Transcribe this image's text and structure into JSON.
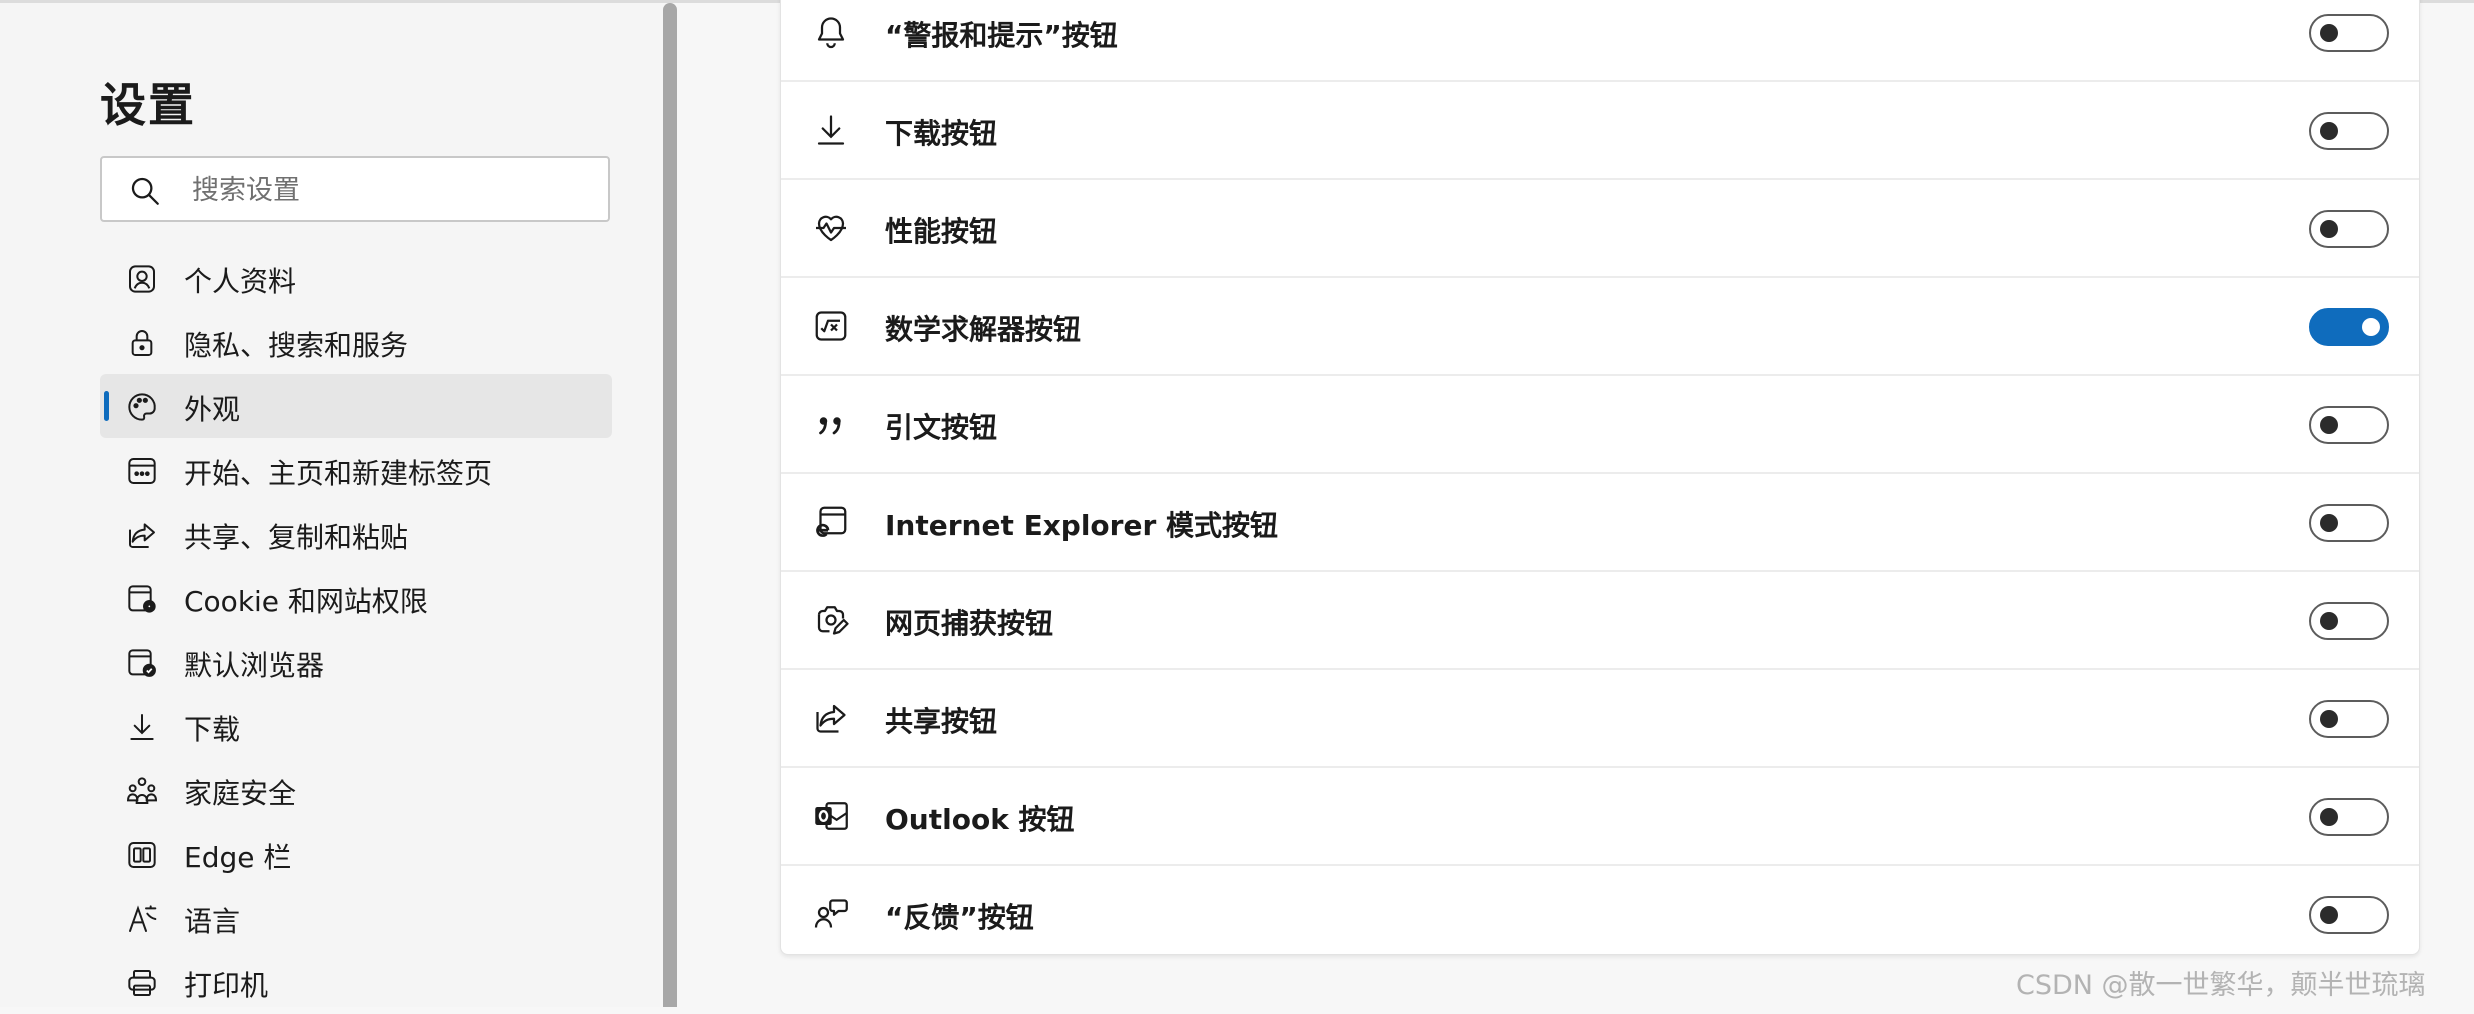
{
  "sidebar": {
    "title": "设置",
    "search": {
      "placeholder": "搜索设置",
      "value": ""
    },
    "items": [
      {
        "label": "个人资料",
        "icon": "profile-icon",
        "active": false
      },
      {
        "label": "隐私、搜索和服务",
        "icon": "lock-icon",
        "active": false
      },
      {
        "label": "外观",
        "icon": "palette-icon",
        "active": true
      },
      {
        "label": "开始、主页和新建标签页",
        "icon": "new-tab-icon",
        "active": false
      },
      {
        "label": "共享、复制和粘贴",
        "icon": "share-icon",
        "active": false
      },
      {
        "label": "Cookie 和网站权限",
        "icon": "site-permissions-icon",
        "active": false
      },
      {
        "label": "默认浏览器",
        "icon": "default-browser-icon",
        "active": false
      },
      {
        "label": "下载",
        "icon": "download-icon",
        "active": false
      },
      {
        "label": "家庭安全",
        "icon": "family-icon",
        "active": false
      },
      {
        "label": "Edge 栏",
        "icon": "edge-bar-icon",
        "active": false
      },
      {
        "label": "语言",
        "icon": "language-icon",
        "active": false
      },
      {
        "label": "打印机",
        "icon": "printer-icon",
        "active": false
      }
    ]
  },
  "toolbar_buttons": [
    {
      "label": "“警报和提示”按钮",
      "icon": "bell-icon",
      "enabled": false
    },
    {
      "label": "下载按钮",
      "icon": "download-icon",
      "enabled": false
    },
    {
      "label": "性能按钮",
      "icon": "heart-pulse-icon",
      "enabled": false
    },
    {
      "label": "数学求解器按钮",
      "icon": "math-solver-icon",
      "enabled": true
    },
    {
      "label": "引文按钮",
      "icon": "quote-icon",
      "enabled": false
    },
    {
      "label": "Internet Explorer 模式按钮",
      "icon": "ie-mode-icon",
      "enabled": false
    },
    {
      "label": "网页捕获按钮",
      "icon": "web-capture-icon",
      "enabled": false
    },
    {
      "label": "共享按钮",
      "icon": "share-icon",
      "enabled": false
    },
    {
      "label": "Outlook 按钮",
      "icon": "outlook-icon",
      "enabled": false
    },
    {
      "label": "“反馈”按钮",
      "icon": "feedback-icon",
      "enabled": false
    }
  ],
  "colors": {
    "accent": "#0f6cbd",
    "toggle_off_border": "#5c5c5c",
    "sidebar_bg": "#f5f5f5"
  },
  "watermark": "CSDN @散一世繁华，颠半世琉璃"
}
